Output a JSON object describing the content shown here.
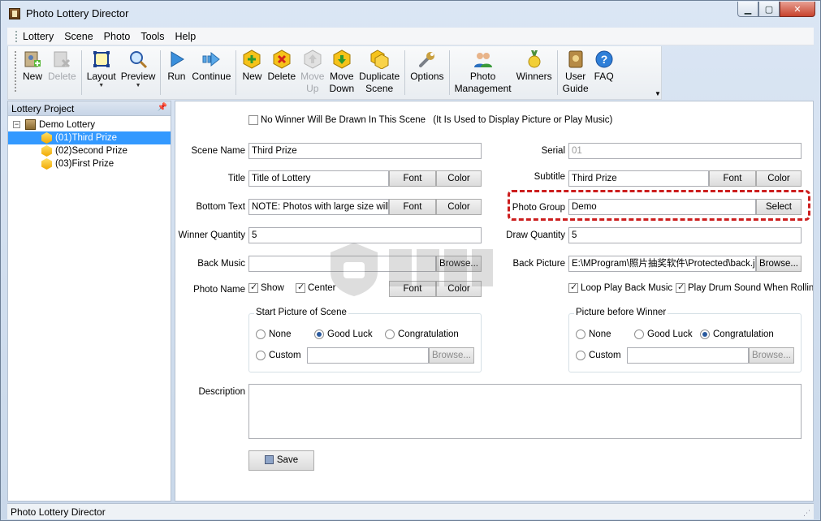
{
  "window": {
    "title": "Photo Lottery Director"
  },
  "menu": [
    "Lottery",
    "Scene",
    "Photo",
    "Tools",
    "Help"
  ],
  "toolbar": {
    "new_lottery": "New",
    "delete_lottery": "Delete",
    "layout": "Layout",
    "preview": "Preview",
    "run": "Run",
    "continue": "Continue",
    "new_scene": "New",
    "delete_scene": "Delete",
    "move_up_1": "Move",
    "move_up_2": "Up",
    "move_down_1": "Move",
    "move_down_2": "Down",
    "duplicate_1": "Duplicate",
    "duplicate_2": "Scene",
    "options": "Options",
    "photo_mgmt_1": "Photo",
    "photo_mgmt_2": "Management",
    "winners": "Winners",
    "user_guide_1": "User",
    "user_guide_2": "Guide",
    "faq": "FAQ"
  },
  "left_pane": {
    "header": "Lottery Project",
    "root": "Demo Lottery",
    "scenes": [
      "(01)Third Prize",
      "(02)Second Prize",
      "(03)First Prize"
    ]
  },
  "form": {
    "no_winner_label": "No Winner Will Be Drawn In This Scene",
    "no_winner_note": "(It Is Used to Display Picture or Play Music)",
    "scene_name_label": "Scene Name",
    "scene_name_value": "Third Prize",
    "serial_label": "Serial",
    "serial_value": "01",
    "title_label": "Title",
    "title_value": "Title of Lottery",
    "subtitle_label": "Subtitle",
    "subtitle_value": "Third Prize",
    "bottom_text_label": "Bottom Text",
    "bottom_text_value": "NOTE: Photos with large size will ma",
    "photo_group_label": "Photo Group",
    "photo_group_value": "Demo",
    "winner_qty_label": "Winner Quantity",
    "winner_qty_value": "5",
    "draw_qty_label": "Draw Quantity",
    "draw_qty_value": "5",
    "back_music_label": "Back Music",
    "back_music_value": "",
    "back_picture_label": "Back Picture",
    "back_picture_value": "E:\\MProgram\\照片抽奖软件\\Protected\\back.jp",
    "photo_name_label": "Photo Name",
    "show_label": "Show",
    "center_label": "Center",
    "loop_music_label": "Loop Play Back Music",
    "drum_sound_label": "Play Drum Sound When Rolling P",
    "font_btn": "Font",
    "color_btn": "Color",
    "select_btn": "Select",
    "browse_btn": "Browse...",
    "start_picture_title": "Start Picture of Scene",
    "before_winner_title": "Picture before Winner",
    "opt_none": "None",
    "opt_good_luck": "Good Luck",
    "opt_congratulation": "Congratulation",
    "opt_custom": "Custom",
    "description_label": "Description",
    "description_value": "",
    "save_btn": "Save"
  },
  "status": {
    "text": "Photo Lottery Director"
  },
  "colors": {
    "highlight": "#cc1e1e",
    "selection": "#3399ff"
  }
}
